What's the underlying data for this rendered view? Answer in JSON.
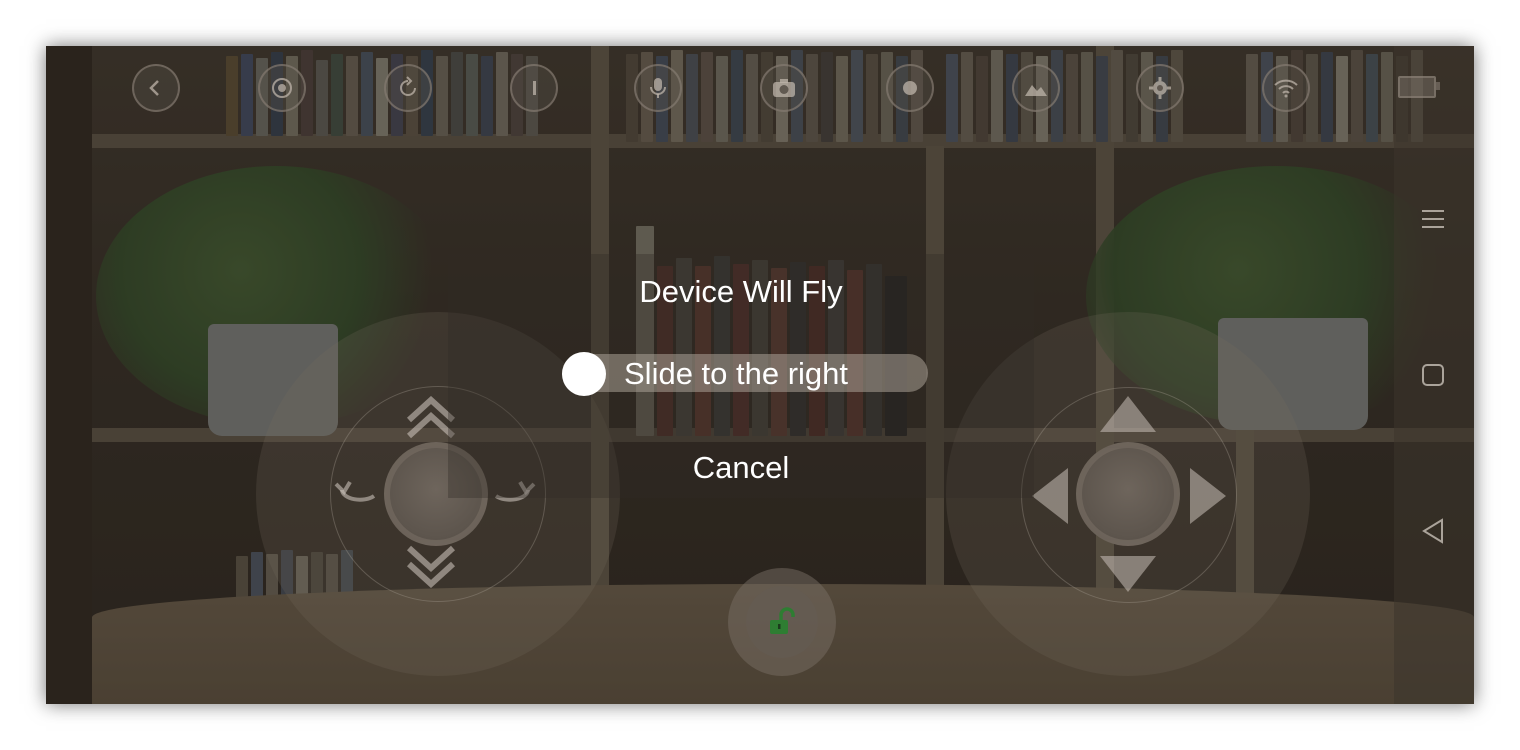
{
  "dialog": {
    "title": "Device Will Fly",
    "slider_label": "Slide to the right",
    "cancel_label": "Cancel"
  },
  "toolbar": {
    "icons": [
      "back-icon",
      "target-icon",
      "rotate-icon",
      "info-icon",
      "microphone-icon",
      "camera-icon",
      "record-icon",
      "gallery-icon",
      "settings-icon",
      "wifi-icon",
      "battery-icon"
    ]
  },
  "nav": {
    "icons": [
      "menu-icon",
      "home-square-icon",
      "back-triangle-icon"
    ]
  },
  "lock": {
    "icon": "unlock-icon",
    "color": "#2e7d32"
  }
}
